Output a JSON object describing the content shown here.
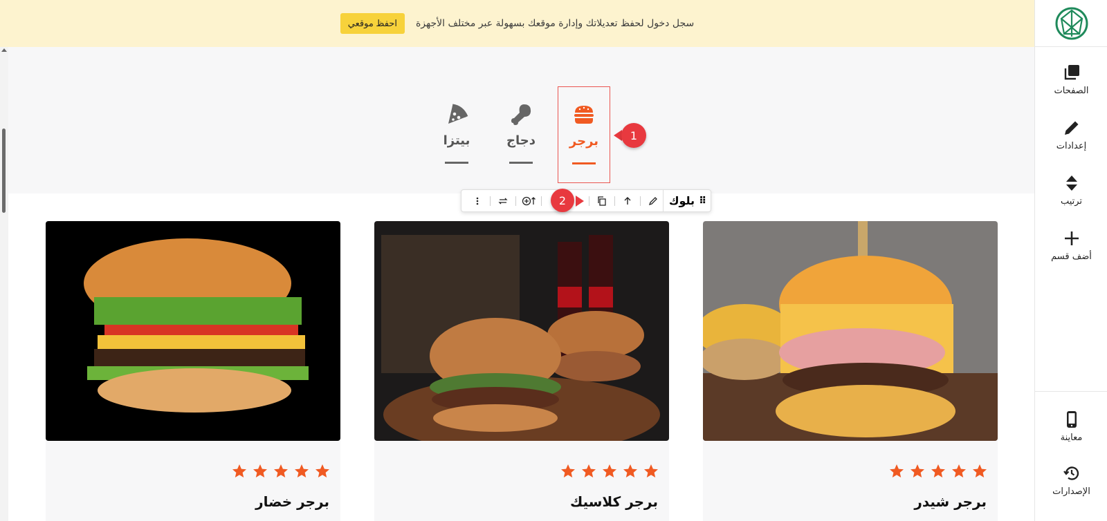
{
  "banner": {
    "message": "سجل دخول لحفظ تعديلاتك وإدارة موقعك بسهولة عبر مختلف الأجهزة",
    "save_button": "احفظ موقعي"
  },
  "sidebar": {
    "items": [
      {
        "label": "الصفحات",
        "icon": "pages-icon"
      },
      {
        "label": "إعدادات",
        "icon": "pencil-icon"
      },
      {
        "label": "ترتيب",
        "icon": "sort-icon"
      },
      {
        "label": "أضف قسم",
        "icon": "plus-icon"
      },
      {
        "label": "معاينة",
        "icon": "mobile-icon"
      },
      {
        "label": "الإصدارات",
        "icon": "history-icon"
      }
    ]
  },
  "tabs": [
    {
      "label": "برجر",
      "icon": "burger-icon",
      "active": true
    },
    {
      "label": "دجاج",
      "icon": "chicken-leg-icon",
      "active": false
    },
    {
      "label": "بيتزا",
      "icon": "pizza-icon",
      "active": false
    }
  ],
  "callouts": [
    "1",
    "2"
  ],
  "toolbar": {
    "block_label": "بلوك"
  },
  "cards": [
    {
      "title": "برجر شيدر",
      "rating": 5
    },
    {
      "title": "برجر كلاسيك",
      "rating": 5
    },
    {
      "title": "برجر خضار",
      "rating": 5
    }
  ],
  "colors": {
    "accent": "#f05a22",
    "banner_bg": "#fdf3cf",
    "banner_button": "#f7d23b",
    "callout": "#e8393f",
    "logo": "#1f8a5b"
  }
}
